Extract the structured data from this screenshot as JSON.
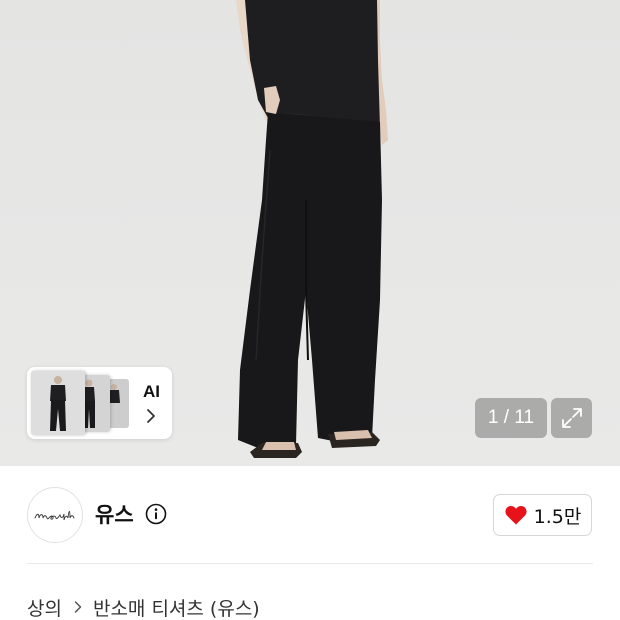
{
  "gallery": {
    "page_indicator": "1 / 11",
    "ai_label": "AI",
    "colors": {
      "background": "#e6e6e5",
      "garment": "#1c1c1e",
      "overlay": "#7a7a7a"
    }
  },
  "brand": {
    "name": "유스",
    "logo_script": "nyouth",
    "likes": "1.5만",
    "heart_color": "#e8121b"
  },
  "breadcrumb": {
    "category": "상의",
    "subcategory": "반소매 티셔츠 (유스)"
  },
  "icons": {
    "expand": "expand-icon",
    "info": "info-icon",
    "heart": "heart-icon",
    "chevron": "chevron-right-icon"
  }
}
